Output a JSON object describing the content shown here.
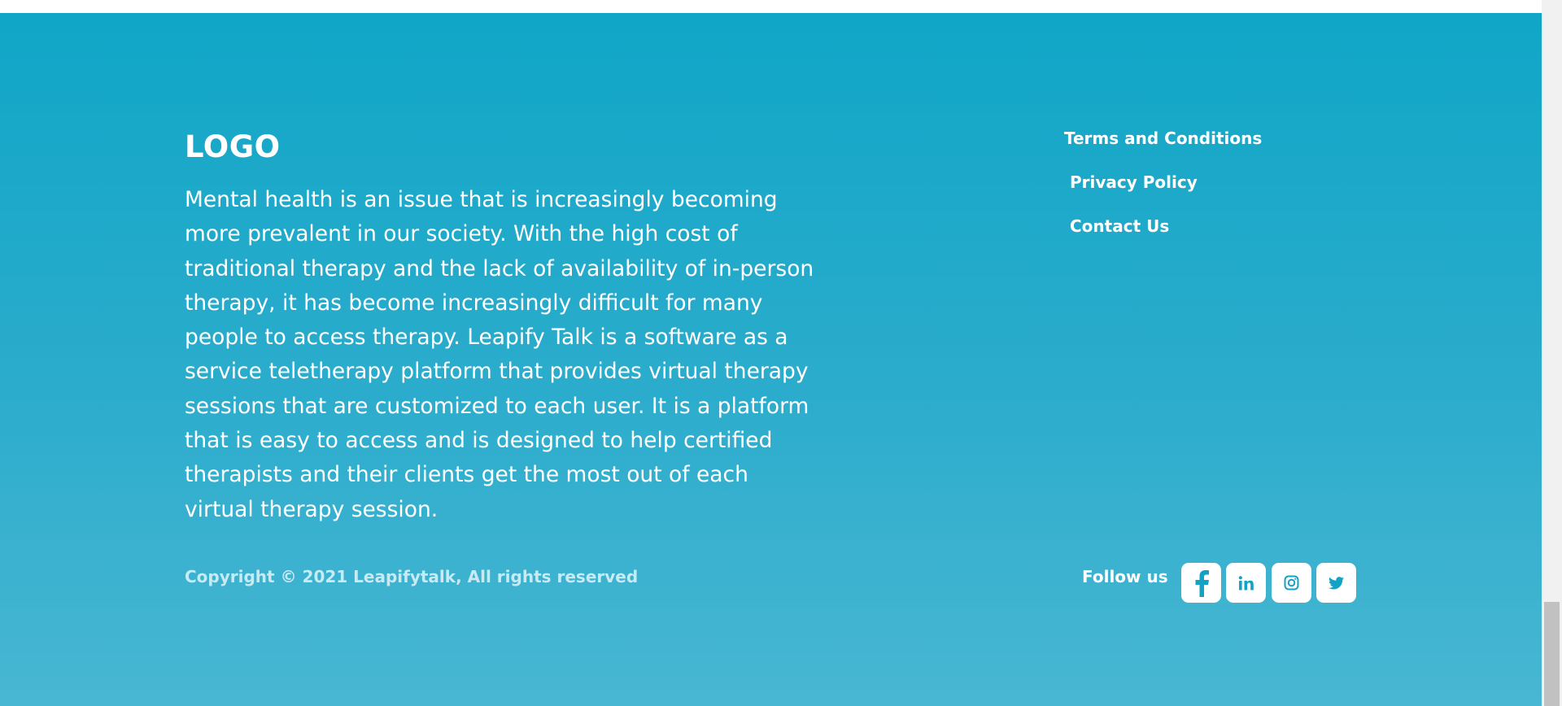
{
  "footer": {
    "logo": "LOGO",
    "description": "Mental health is an issue that is increasingly becoming more prevalent in our society. With the high cost of traditional therapy and the lack of availability of in-person therapy, it has become increasingly difficult for many people to access therapy. Leapify Talk is a software as a service teletherapy platform that provides virtual therapy sessions that are customized to each user. It is a platform that is easy to access and is designed to help certified therapists and their clients get the most out of each virtual therapy session.",
    "links": [
      {
        "label": "Terms and Conditions"
      },
      {
        "label": "Privacy Policy"
      },
      {
        "label": "Contact Us"
      }
    ],
    "copyright": "Copyright © 2021 Leapifytalk, All rights reserved",
    "follow_label": "Follow us",
    "social": [
      {
        "name": "facebook",
        "icon": "facebook-icon"
      },
      {
        "name": "linkedin",
        "icon": "linkedin-icon"
      },
      {
        "name": "instagram",
        "icon": "instagram-icon"
      },
      {
        "name": "twitter",
        "icon": "twitter-icon"
      }
    ],
    "colors": {
      "gradient_top": "#10a6c7",
      "gradient_bottom": "#48b7d3",
      "text": "#ffffff",
      "icon": "#12a2c5"
    }
  }
}
